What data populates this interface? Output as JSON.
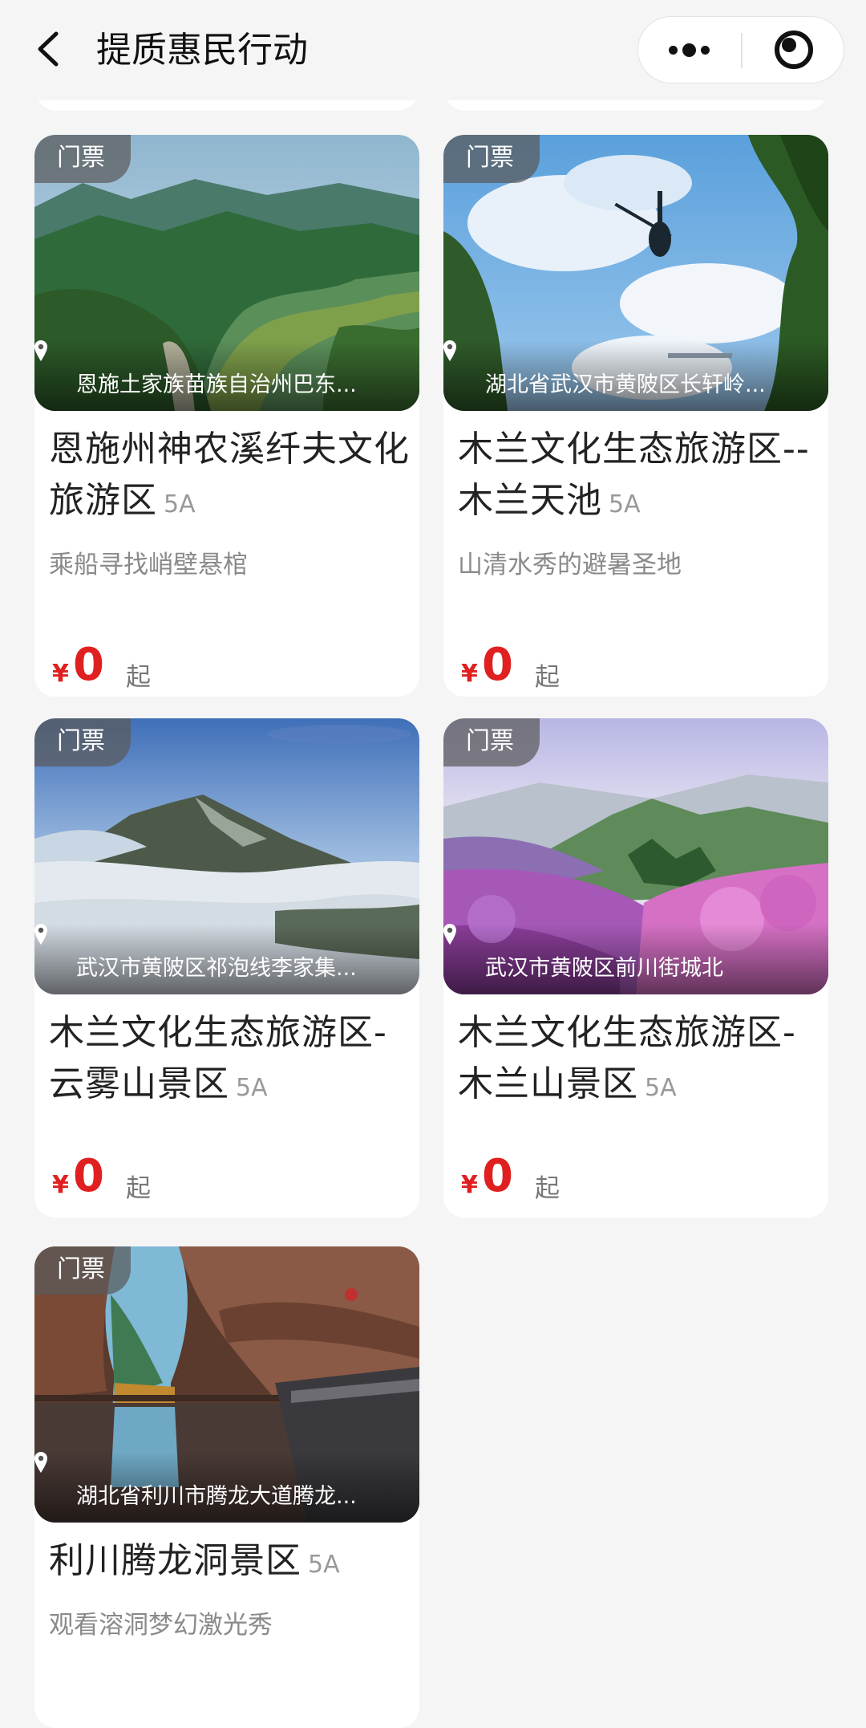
{
  "header": {
    "title": "提质惠民行动"
  },
  "cards": [
    {
      "tag": "门票",
      "location": "恩施土家族苗族自治州巴东...",
      "name": "恩施州神农溪纤夫文化旅游区",
      "level": "5A",
      "description": "乘船寻找峭壁悬棺",
      "price_currency": "¥",
      "price": "0",
      "price_unit": "起"
    },
    {
      "tag": "门票",
      "location": "湖北省武汉市黄陂区长轩岭...",
      "name": "木兰文化生态旅游区--木兰天池",
      "level": "5A",
      "description": "山清水秀的避暑圣地",
      "price_currency": "¥",
      "price": "0",
      "price_unit": "起"
    },
    {
      "tag": "门票",
      "location": "武汉市黄陂区祁泡线李家集...",
      "name": "木兰文化生态旅游区-云雾山景区",
      "level": "5A",
      "description": "",
      "price_currency": "¥",
      "price": "0",
      "price_unit": "起"
    },
    {
      "tag": "门票",
      "location": "武汉市黄陂区前川街城北",
      "name": "木兰文化生态旅游区-木兰山景区",
      "level": "5A",
      "description": "",
      "price_currency": "¥",
      "price": "0",
      "price_unit": "起"
    },
    {
      "tag": "门票",
      "location": "湖北省利川市腾龙大道腾龙...",
      "name": "利川腾龙洞景区",
      "level": "5A",
      "description": "观看溶洞梦幻激光秀",
      "price_currency": "¥",
      "price": "",
      "price_unit": ""
    }
  ]
}
